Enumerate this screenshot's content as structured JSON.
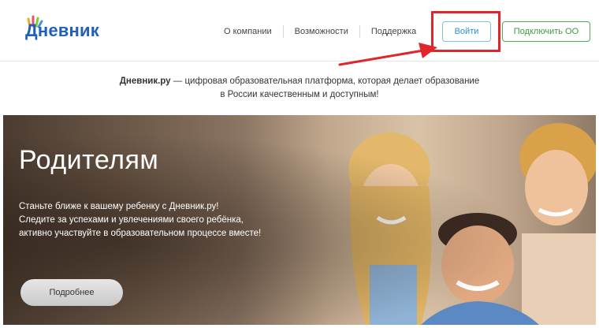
{
  "header": {
    "logo_text": "Дневник",
    "nav": [
      "О компании",
      "Возможности",
      "Поддержка"
    ],
    "login_label": "Войти",
    "connect_label": "Подключить ОО"
  },
  "tagline": {
    "brand": "Дневник.ру",
    "line1_rest": " — цифровая образовательная платформа, которая делает образование",
    "line2": "в России качественным и доступным!"
  },
  "hero": {
    "title": "Родителям",
    "lines": [
      "Станьте ближе к вашему ребенку с Дневник.ру!",
      "Следите за успехами и увлечениями своего ребёнка,",
      "активно участвуйте в образовательном процессе вместе!"
    ],
    "more_label": "Подробнее"
  },
  "colors": {
    "accent_blue": "#2a8fd0",
    "accent_green": "#3f9a3f",
    "highlight_red": "#e0262a"
  }
}
